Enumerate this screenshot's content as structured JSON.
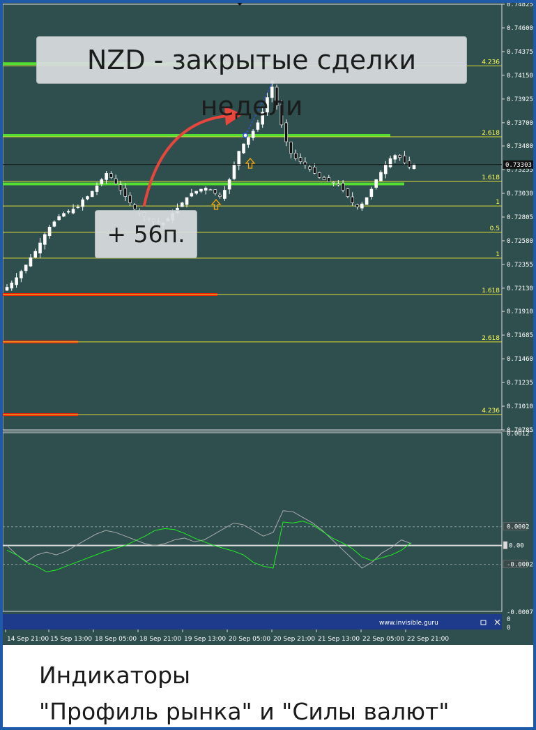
{
  "chart_data": [
    {
      "type": "candlestick",
      "title": "NZD - закрытые сделки недели",
      "ylim": [
        0.70785,
        0.74825
      ],
      "y_ticks": [
        0.74825,
        0.746,
        0.74375,
        0.7415,
        0.73925,
        0.737,
        0.7348,
        0.73255,
        0.7303,
        0.72805,
        0.7258,
        0.72355,
        0.7213,
        0.7191,
        0.71685,
        0.7146,
        0.71235,
        0.7101,
        0.70785
      ],
      "y_tick_labels": [
        "0.74825",
        "0.74600",
        "0.74375",
        "0.74150",
        "0.73925",
        "0.73700",
        "0.73480",
        "0.73255",
        "0.73030",
        "0.72805",
        "0.72580",
        "0.72355",
        "0.72130",
        "0.71910",
        "0.71685",
        "0.71460",
        "0.71235",
        "0.71010",
        "0.70785"
      ],
      "current_price": "0.73303",
      "x_labels": [
        "14 Sep 21:00",
        "15 Sep 13:00",
        "18 Sep 05:00",
        "18 Sep 21:00",
        "19 Sep 13:00",
        "20 Sep 05:00",
        "20 Sep 21:00",
        "21 Sep 13:00",
        "22 Sep 05:00",
        "22 Sep 21:00"
      ],
      "close_path": [
        0.7214,
        0.7218,
        0.7223,
        0.7229,
        0.7235,
        0.7242,
        0.7248,
        0.7256,
        0.7264,
        0.7271,
        0.7276,
        0.7281,
        0.7284,
        0.7286,
        0.7288,
        0.729,
        0.7297,
        0.73,
        0.7305,
        0.731,
        0.7316,
        0.7322,
        0.7318,
        0.7312,
        0.7306,
        0.73,
        0.7294,
        0.7288,
        0.7284,
        0.7281,
        0.7279,
        0.7276,
        0.7273,
        0.7275,
        0.7279,
        0.7284,
        0.7289,
        0.7294,
        0.7299,
        0.7303,
        0.7305,
        0.7307,
        0.7308,
        0.7306,
        0.7303,
        0.73,
        0.7306,
        0.7316,
        0.733,
        0.7343,
        0.735,
        0.7356,
        0.7362,
        0.737,
        0.738,
        0.7394,
        0.7404,
        0.7386,
        0.7368,
        0.7352,
        0.7341,
        0.7336,
        0.7333,
        0.733,
        0.7326,
        0.7322,
        0.7318,
        0.7316,
        0.7314,
        0.7313,
        0.7311,
        0.7306,
        0.73,
        0.7294,
        0.729,
        0.7293,
        0.7299,
        0.7307,
        0.7316,
        0.7323,
        0.733,
        0.7336,
        0.7339,
        0.7337,
        0.7332,
        0.7328,
        0.733
      ],
      "fib_levels": [
        {
          "label": "4.236",
          "price": 0.7424
        },
        {
          "label": "2.618",
          "price": 0.73567
        },
        {
          "label": "1.618",
          "price": 0.73143
        },
        {
          "label": "1",
          "price": 0.7291
        },
        {
          "label": "0.5",
          "price": 0.7266
        },
        {
          "label": "1",
          "price": 0.72415
        },
        {
          "label": "1.618",
          "price": 0.7207
        },
        {
          "label": "2.618",
          "price": 0.7162
        },
        {
          "label": "4.236",
          "price": 0.7093
        }
      ],
      "support_resistance": [
        {
          "color": "#55dd33",
          "price": 0.7426
        },
        {
          "color": "#55dd33",
          "price": 0.7358
        },
        {
          "color": "#55dd33",
          "price": 0.7312
        },
        {
          "color": "#ee2200",
          "price": 0.7207
        },
        {
          "color": "#ee2200",
          "price": 0.7162
        },
        {
          "color": "#ee2200",
          "price": 0.7093
        }
      ],
      "profit_annotation": "+ 56п."
    },
    {
      "type": "line",
      "ylim": [
        -0.0007,
        0.0012
      ],
      "y_tick_labels": [
        "0.0012",
        "0.0002",
        "0.00",
        "-0.0002",
        "-0.0007",
        "0",
        "0"
      ],
      "series_colors": [
        "#22ee22",
        "#aaaaaa"
      ],
      "green_path": [
        -5e-05,
        -0.0001,
        -0.00018,
        -0.00022,
        -0.00028,
        -0.00026,
        -0.00022,
        -0.00018,
        -0.00014,
        -0.0001,
        -6e-05,
        -3e-05,
        0.0,
        5e-05,
        0.0001,
        0.00016,
        0.00018,
        0.00017,
        0.00013,
        8e-05,
        4e-05,
        0.0,
        -3e-05,
        -6e-05,
        -0.0001,
        -0.00018,
        -0.00022,
        -0.00024,
        0.00025,
        0.00024,
        0.00026,
        0.00022,
        0.00015,
        8e-05,
        3e-05,
        -3e-05,
        -0.00012,
        -0.00016,
        -0.00013,
        -0.0001,
        -5e-05,
        3e-05
      ],
      "gray_path": [
        0.0,
        -0.0001,
        -0.00017,
        -0.0001,
        -7e-05,
        -0.0001,
        -6e-05,
        0.0,
        6e-05,
        0.00012,
        0.00016,
        0.00014,
        0.0001,
        6e-05,
        2e-05,
        0.0,
        2e-05,
        6e-05,
        8e-05,
        4e-05,
        6e-05,
        0.00012,
        0.00018,
        0.00024,
        0.00022,
        0.00016,
        0.0001,
        0.00014,
        0.00037,
        0.00036,
        0.0003,
        0.00024,
        0.00016,
        6e-05,
        -4e-05,
        -0.00014,
        -0.00024,
        -0.00018,
        -8e-05,
        -2e-05,
        6e-05,
        2e-05
      ]
    }
  ],
  "annotations": {
    "title": "NZD - закрытые сделки недели",
    "profit": "+ 56п."
  },
  "footer": {
    "line1": "Индикаторы",
    "line2": "\"Профиль рынка\" и \"Силы валют\""
  },
  "watermark": "www.invisible.guru"
}
